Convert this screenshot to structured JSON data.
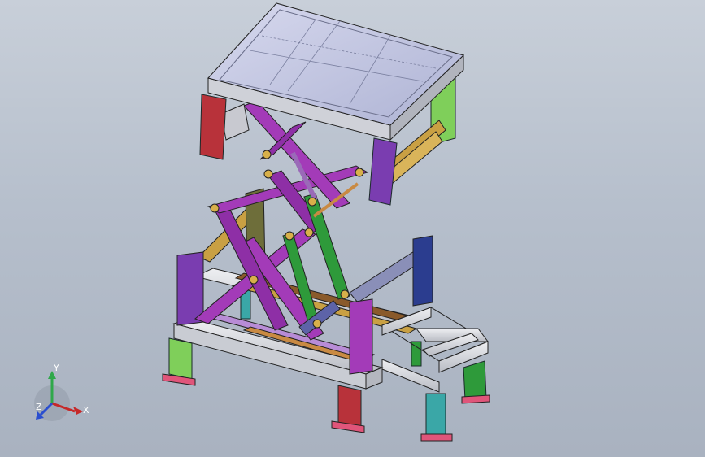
{
  "triad": {
    "x_label": "X",
    "y_label": "Y",
    "z_label": "Z"
  },
  "colors": {
    "platform_top": "#c9cce3",
    "frame": "#d9dbe0",
    "scissor_arm": "#a33bb8",
    "cylinder": "#2e9a3a",
    "leg_red": "#b8323a",
    "leg_green": "#7fcf5a",
    "leg_purple": "#7a3db0",
    "leg_navy": "#2b3d8f",
    "beam_tan": "#c9a043",
    "beam_brown": "#8a5a2b",
    "leg_teal": "#3aa7a7",
    "foot_pink": "#e0557a"
  },
  "icons": [
    "axis-triad-icon"
  ]
}
